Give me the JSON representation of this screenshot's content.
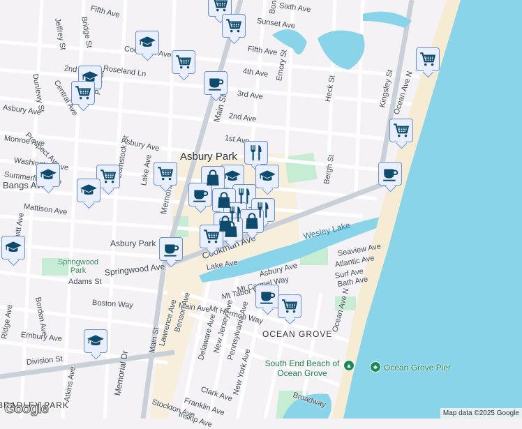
{
  "map": {
    "city_label": "Asbury Park",
    "areas": [
      "OCEAN GROVE",
      "BRADLEY PARK"
    ],
    "parks": [
      "Springwood Park"
    ],
    "water": [
      "Wesley Lake"
    ],
    "pois": [
      "South End Beach of Ocean Grove",
      "Ocean Grove Pier"
    ],
    "streets": {
      "fifth_ave_top": "Fifth Ave",
      "bond": "Bond St",
      "sixth": "Sixth Ave",
      "sunset": "Sunset Ave",
      "fifth": "Fifth Ave",
      "fourth": "4th Ave",
      "third": "3rd Ave",
      "second": "2nd Ave",
      "first": "1st Ave",
      "jeffrey": "Jeffrey St",
      "bridge": "Bridge St",
      "cookman_top": "Cookman Ave",
      "roseland": "Roseland Ln",
      "second_w": "2nd Ave",
      "central": "Central Ave",
      "pine": "Pine St",
      "dunlewy": "Dunlewy St",
      "asbury_w": "Asbury Ave",
      "prospect": "Prospect Ave",
      "monroe": "Monroe Ave",
      "asbury_mid": "Asbury Ave",
      "washington": "Washington Ave",
      "summerfield": "Summerfield Ave",
      "bangs": "Bangs Ave",
      "mattison": "Mattison Ave",
      "dewitt": "Dewitt Ave",
      "comstock": "Comstock St",
      "lake_st": "Lake Ave",
      "memorial": "Memorial Dr",
      "main": "Main St",
      "emory": "Emory St",
      "heck": "Heck St",
      "bergh": "Bergh St",
      "kingsley": "Kingsley St",
      "ocean_n": "Ocean Ave N",
      "asbury_park_ave": "Asbury Park",
      "springwood": "Springwood Ave",
      "adams": "Adams St",
      "borden": "Borden Ave",
      "boston": "Boston Way",
      "cookman": "Cookman Ave",
      "lake_ave": "Lake Ave",
      "asbury_og": "Asbury Ave",
      "mt_carmel": "Mt Carmel Way",
      "mt_tabor": "Mt Tabor Way",
      "mt_hermon": "Mt Hermon Way",
      "main_ave": "Main Ave",
      "seaview": "Seaview Ave",
      "atlantic": "Atlantic Ave",
      "surf": "Surf Ave",
      "bath": "Bath Ave",
      "ocean_og": "Ocean Ave N",
      "embury": "Embury Ave",
      "ridge": "Ridge Ave",
      "division": "Division St",
      "atkins": "Atkins Ave",
      "memorial_s": "Memorial Dr",
      "main_s": "Main St",
      "lawrence": "Lawrence Ave",
      "benson": "Benson Ave",
      "delaware": "Delaware Ave",
      "new_jersey": "New Jersey Ave",
      "pennsylvania": "Pennsylvania Ave",
      "clark": "Clark Ave",
      "new_york": "New York Ave",
      "franklin": "Franklin Ave",
      "stockton": "Stockton Ave",
      "inskip": "Inskip Ave",
      "broadway": "Broadway"
    },
    "attribution": "Map data ©2025 Google",
    "logo": "Google"
  },
  "colors": {
    "water": "#8ad4ea",
    "park": "#c6ecd4",
    "sand": "#f6ecd3",
    "marker_bg": "#e9effd",
    "marker_border": "#6a8ee0",
    "icon": "#0d4a6b"
  }
}
